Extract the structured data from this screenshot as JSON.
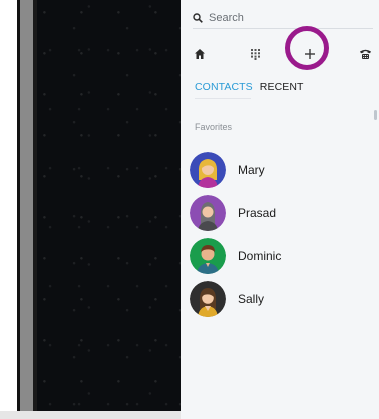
{
  "search": {
    "placeholder": "Search"
  },
  "toolbar": {
    "items": [
      {
        "icon": "home-icon"
      },
      {
        "icon": "dialpad-icon"
      },
      {
        "icon": "add-icon"
      },
      {
        "icon": "phone-icon"
      }
    ]
  },
  "tabs": [
    {
      "label": "CONTACTS",
      "active": true
    },
    {
      "label": "RECENT",
      "active": false
    }
  ],
  "favorites": {
    "label": "Favorites",
    "contacts": [
      {
        "name": "Mary",
        "avatar": "avatar-mary",
        "bg": "#3b4bb8"
      },
      {
        "name": "Prasad",
        "avatar": "avatar-prasad",
        "bg": "#8c4db3"
      },
      {
        "name": "Dominic",
        "avatar": "avatar-dominic",
        "bg": "#1a9d4c"
      },
      {
        "name": "Sally",
        "avatar": "avatar-sally",
        "bg": "#2f2f2f"
      }
    ]
  },
  "colors": {
    "accent": "#2a9bd6",
    "highlight": "#9a1a8c"
  }
}
